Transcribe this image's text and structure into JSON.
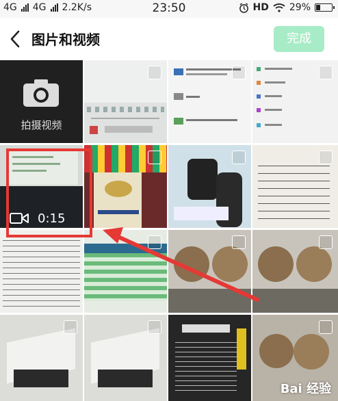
{
  "status_bar": {
    "network_1": "4G",
    "network_2": "4G",
    "speed": "2.2K/s",
    "time": "23:50",
    "hd": "HD",
    "battery_text": "29%",
    "battery_level": 0.29
  },
  "header": {
    "title": "图片和视频",
    "done_label": "完成"
  },
  "grid": {
    "camera_label": "拍摄视频",
    "video_duration": "0:15"
  },
  "watermark": "Bai 经验",
  "colors": {
    "done_bg": "#a7ecc6",
    "highlight": "#e53935",
    "camera_tile_bg": "#202020"
  }
}
